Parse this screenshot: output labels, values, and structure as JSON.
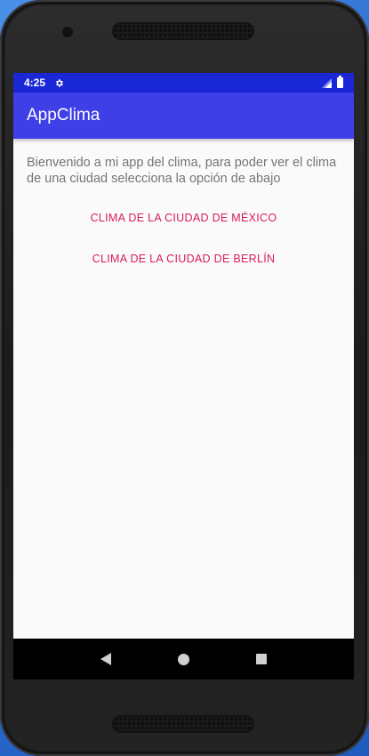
{
  "status_bar": {
    "time": "4:25",
    "icons": [
      "gear-icon",
      "signal-icon",
      "battery-icon"
    ]
  },
  "app_bar": {
    "title": "AppClima",
    "color": "#3f3fe8"
  },
  "main": {
    "welcome_text": "Bienvenido a mi app del clima, para poder ver el clima de una ciudad selecciona la opción de abajo",
    "buttons": [
      {
        "label": "CLIMA DE LA CIUDAD DE MÉXICO"
      },
      {
        "label": "CLIMA DE LA CIUDAD DE BERLÍN"
      }
    ],
    "accent_color": "#d81b60"
  },
  "nav_bar": {
    "icons": [
      "back-icon",
      "home-icon",
      "recents-icon"
    ]
  }
}
